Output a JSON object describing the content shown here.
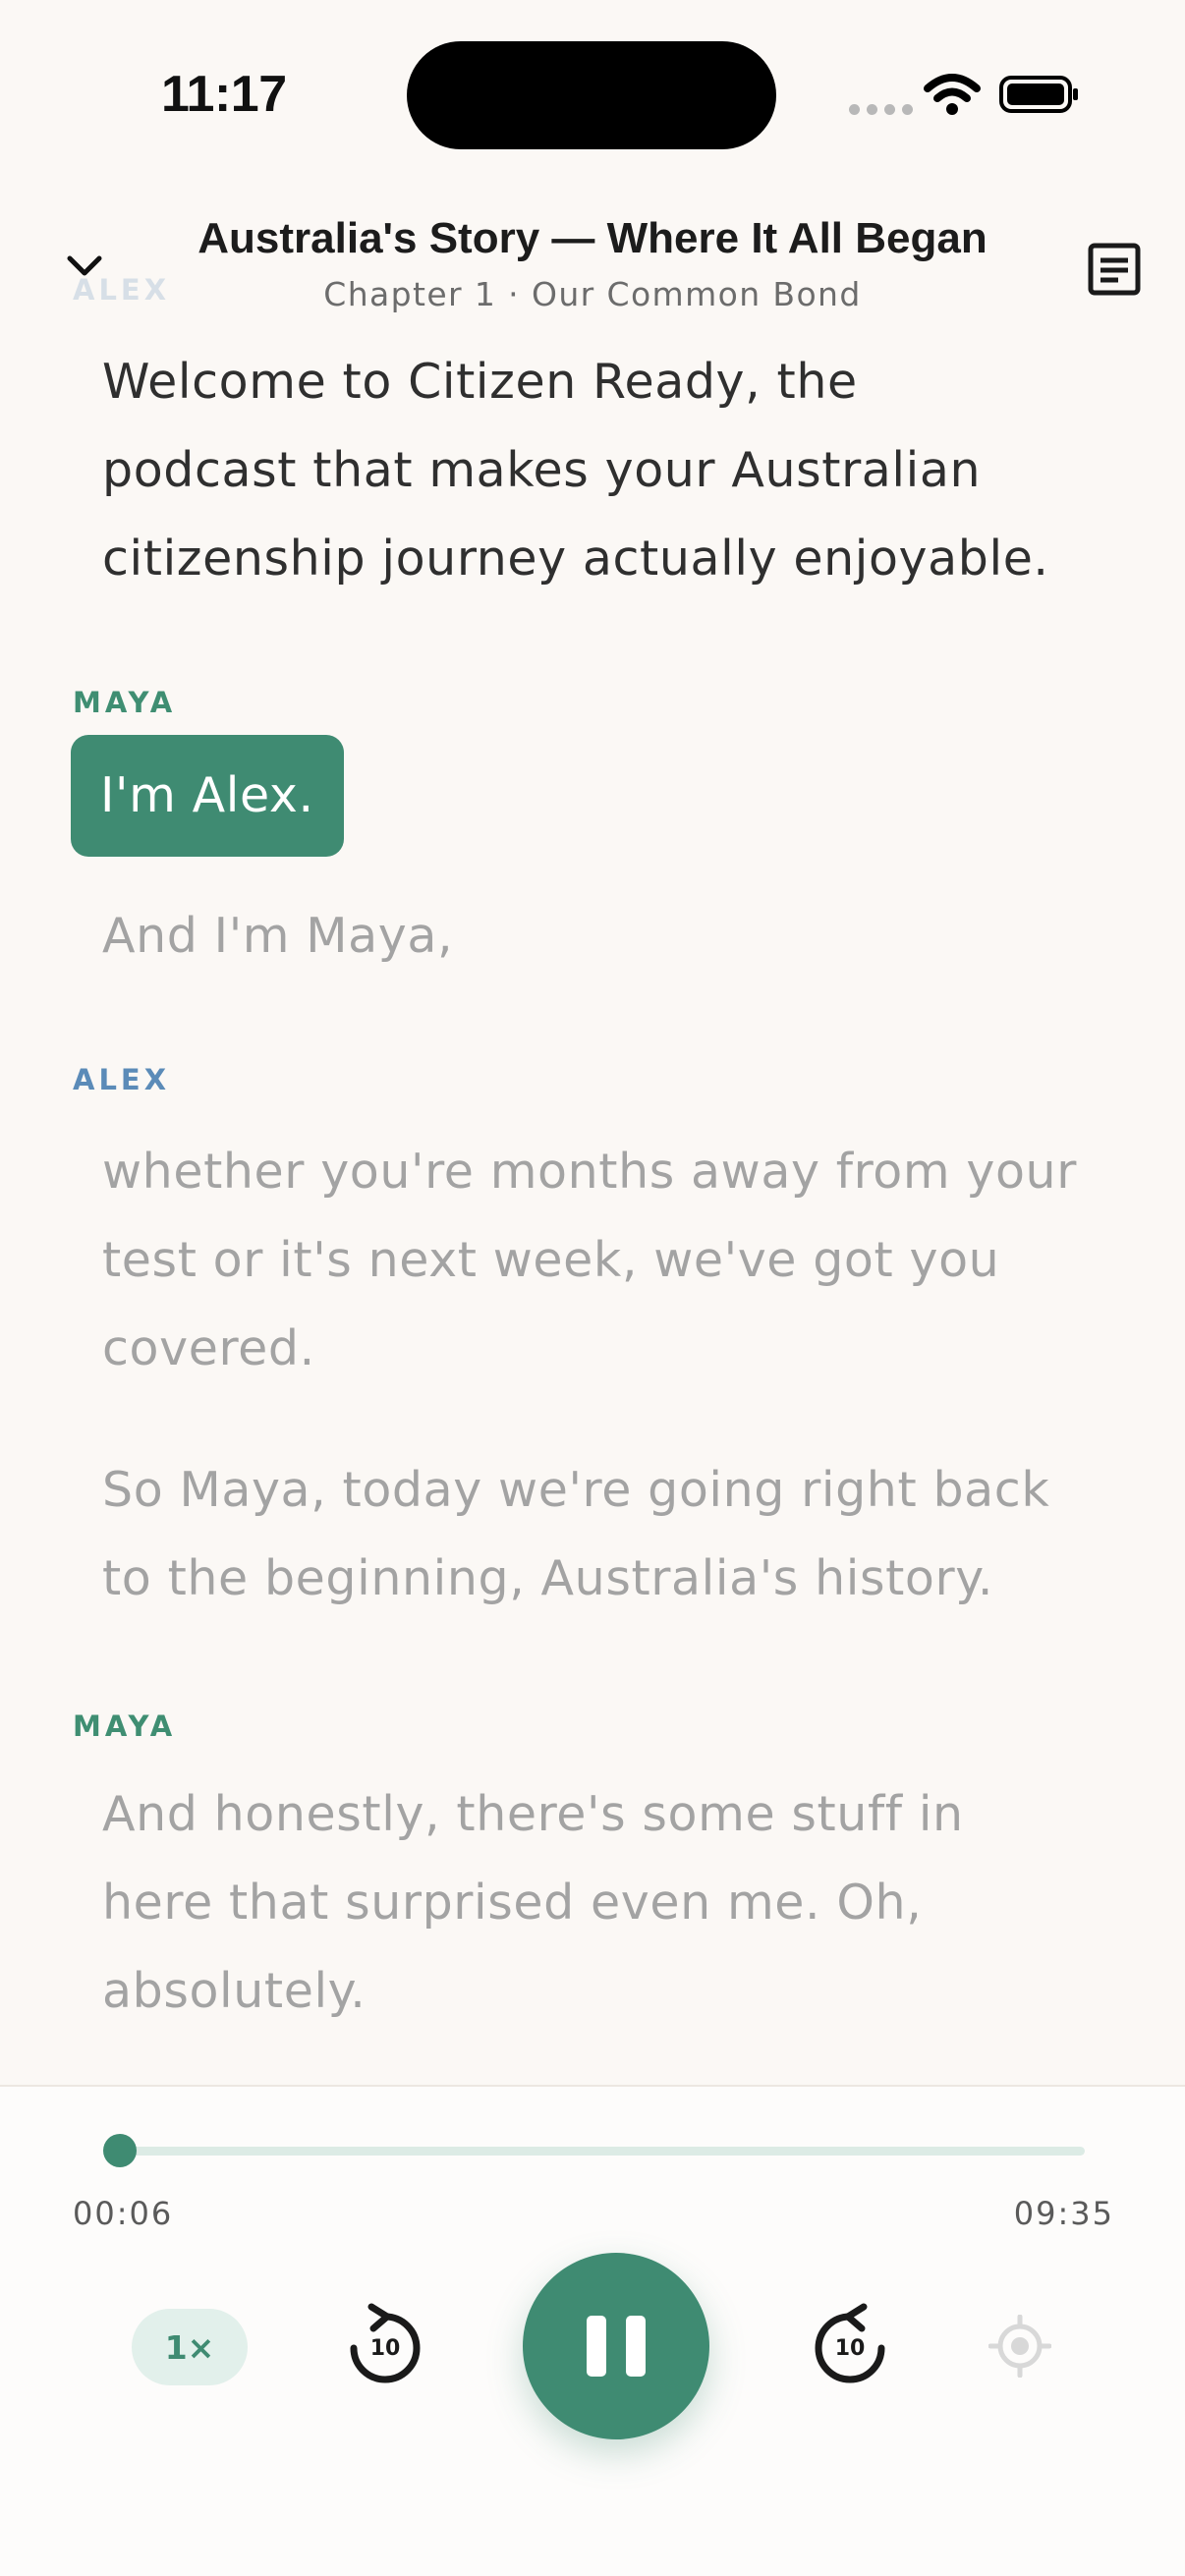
{
  "status": {
    "time": "11:17"
  },
  "header": {
    "title": "Australia's Story — Where It All Began",
    "subtitle": "Chapter 1 · Our Common Bond"
  },
  "transcript": {
    "blocks": [
      {
        "speaker": "ALEX",
        "lines": [
          "Welcome to Citizen Ready, the",
          "podcast that makes your Australian",
          "citizenship journey actually enjoyable."
        ]
      },
      {
        "speaker": "MAYA",
        "active": "I'm Alex.",
        "next": "And I'm Maya,"
      },
      {
        "speaker": "ALEX",
        "lines": [
          "whether you're months away from your",
          "test or it's next week, we've got you",
          "covered."
        ],
        "lines2": [
          "So Maya, today we're going right back",
          "to the beginning, Australia's history."
        ]
      },
      {
        "speaker": "MAYA",
        "lines": [
          "And honestly, there's some stuff in",
          "here that surprised even me. Oh,",
          "absolutely."
        ]
      }
    ]
  },
  "player": {
    "elapsed": "00:06",
    "total": "09:35",
    "progress_fraction": 0.0104,
    "speed": "1×",
    "skip_back_seconds": "10",
    "skip_forward_seconds": "10",
    "accent_color": "#3f8b72"
  },
  "icons": {
    "collapse": "chevron-down-icon",
    "transcript": "transcript-icon",
    "skip_back": "rotate-ccw-icon",
    "skip_forward": "rotate-cw-icon",
    "locate": "locate-icon"
  }
}
